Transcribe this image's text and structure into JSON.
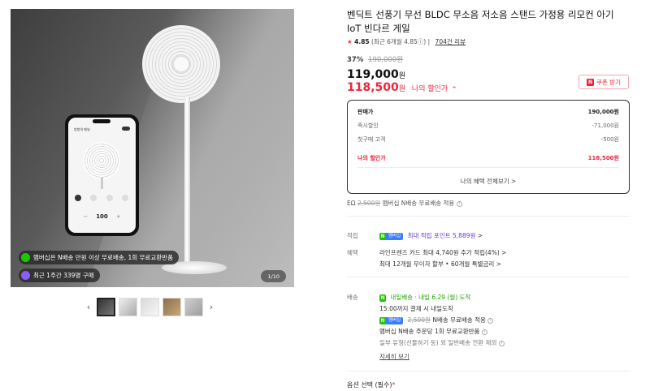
{
  "gallery": {
    "phone": {
      "title": "방향의 패널",
      "speed": "100",
      "minus": "−",
      "plus": "+"
    },
    "promo_membership": "멤버십은 N배송 만원 이상 무료배송, 1회 무료교환반품",
    "promo_purchases": "최근 1주간 339명 구매",
    "page_counter": "1/10",
    "prev_arrow": "‹",
    "next_arrow": "›"
  },
  "product": {
    "title": "벤딕트 선풍기 무선 BLDC 무소음 저소음 스탠드 가정용 리모컨 아기 IoT 빈다르 게일",
    "rating_star": "★",
    "rating": "4.85",
    "rating_detail": "(최근 6개월 4.85ⓘ)",
    "review_count": "704건 리뷰",
    "discount_pct": "37%",
    "original_price": "190,000원",
    "price": "119,000",
    "price_unit": "원",
    "my_price": "118,500",
    "my_price_unit": "원",
    "my_price_label": "나의 할인가",
    "my_price_chevron": "^",
    "coupon_n": "N",
    "coupon_label": "쿠폰 받기"
  },
  "price_box": {
    "rows": [
      {
        "label": "판매가",
        "value": "190,000원"
      },
      {
        "label": "즉시할인",
        "value": "-71,000원"
      },
      {
        "label": "첫구매 고객",
        "value": "-500원"
      },
      {
        "label": "나의 할인가",
        "value": "118,500원"
      }
    ],
    "more_label": "나의 혜택 전체보기 >"
  },
  "membership_shipping": {
    "prefix": "EΩ",
    "strike": "2,500원",
    "text": "멤버십 N배송 무료배송 적용"
  },
  "points": {
    "label": "적립",
    "badge_g": "N",
    "badge_b": "멤버십",
    "text": "최대 적립 포인트 5,889원",
    "chevron": ">"
  },
  "benefits": {
    "label": "혜택",
    "line1": "라인프렌즈 카드 최대 4,740원 추가 적립(4%)",
    "line2": "최대 12개월 무이자 할부 • 60개월 특별금리",
    "chevron": ">"
  },
  "delivery": {
    "label": "배송",
    "badge_g": "N",
    "badge_text": "내일배송",
    "arrival": "· 내일 6.29 (월) 도착",
    "cutoff": "15:00까지 결제 시 내일도착",
    "ship_badge_g": "N",
    "ship_badge_b": "멤버십",
    "ship_strike": "2,500원",
    "ship_text": "N배송 무료배송 적용",
    "return_text": "멤버십 N배송 주문당 1회 무료교환반품",
    "exception_text": "일부 유형(선물하기 등) 외 일반배송 전환 제외",
    "detail_link": "자세히 보기"
  },
  "options": {
    "label": "옵션 선택 (필수)",
    "required_mark": "*"
  }
}
